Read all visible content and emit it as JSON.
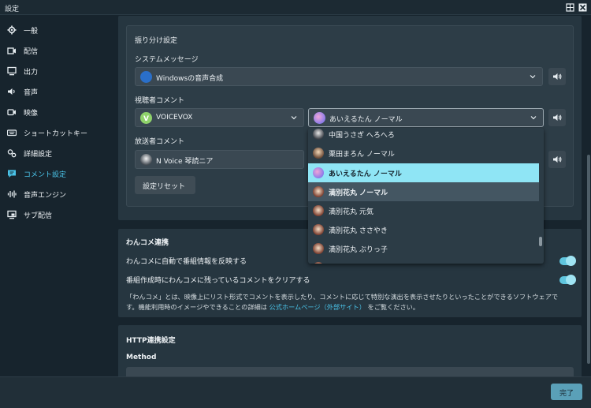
{
  "window": {
    "title": "設定"
  },
  "sidebar": {
    "items": [
      {
        "label": "一般",
        "icon": "gear-icon"
      },
      {
        "label": "配信",
        "icon": "broadcast-icon"
      },
      {
        "label": "出力",
        "icon": "monitor-icon"
      },
      {
        "label": "音声",
        "icon": "speaker-icon"
      },
      {
        "label": "映像",
        "icon": "camera-icon"
      },
      {
        "label": "ショートカットキー",
        "icon": "keyboard-icon"
      },
      {
        "label": "詳細設定",
        "icon": "gears-icon"
      },
      {
        "label": "コメント設定",
        "icon": "comment-icon",
        "active": true
      },
      {
        "label": "音声エンジン",
        "icon": "waveform-icon"
      },
      {
        "label": "サブ配信",
        "icon": "sub-stream-icon"
      }
    ]
  },
  "assign": {
    "heading": "振り分け設定",
    "system_label": "システムメッセージ",
    "system_voice": "Windowsの音声合成",
    "viewer_label": "視聴者コメント",
    "viewer_engine": "VOICEVOX",
    "viewer_voice": "あいえるたん ノーマル",
    "broadcaster_label": "放送者コメント",
    "broadcaster_voice": "N Voice 琴読ニア",
    "reset_label": "設定リセット"
  },
  "voice_dropdown": {
    "options": [
      {
        "label": "中国うさぎ へろへろ"
      },
      {
        "label": "栗田まろん ノーマル"
      },
      {
        "label": "あいえるたん ノーマル",
        "selected": true
      },
      {
        "label": "満別花丸 ノーマル",
        "hovered": true
      },
      {
        "label": "満別花丸 元気"
      },
      {
        "label": "満別花丸 ささやき"
      },
      {
        "label": "満別花丸 ぶりっ子"
      },
      {
        "label": ""
      }
    ]
  },
  "wancome": {
    "heading": "わんコメ連携",
    "option1": "わんコメに自動で番組情報を反映する",
    "option1_on": true,
    "option2": "番組作成時にわんコメに残っているコメントをクリアする",
    "option2_on": true,
    "desc_line1": "「わんコメ」とは、映像上にリスト形式でコメントを表示したり、コメントに応じて特別な演出を表示させたりといったことができるソフトウェアで",
    "desc_line2_pre": "す。機能利用時のイメージやできることの詳細は",
    "desc_link": "公式ホームページ（外部サイト）",
    "desc_line2_post": "をご覧ください。"
  },
  "http": {
    "heading": "HTTP連携設定",
    "method_label": "Method"
  },
  "footer": {
    "done_label": "完了"
  },
  "colors": {
    "accent": "#4ac3e8",
    "selected_option": "#8fe5f5",
    "toggle_on": "#5fc5de",
    "done_button": "#5aa0b8"
  }
}
